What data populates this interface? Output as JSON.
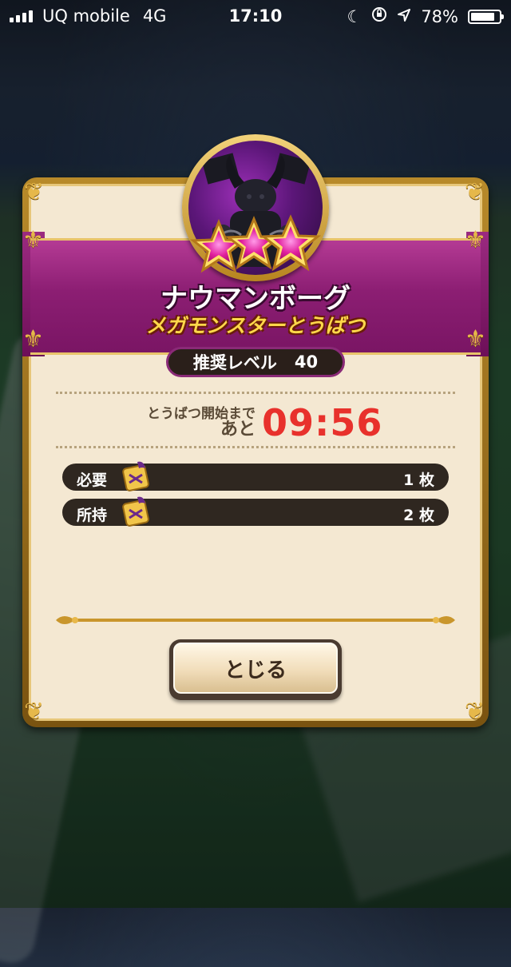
{
  "status_bar": {
    "carrier": "UQ mobile",
    "network": "4G",
    "time": "17:10",
    "battery": "78%",
    "battery_level": 0.78
  },
  "dialog": {
    "monster_name": "ナウマンボーグ",
    "subtitle": "メガモンスターとうばつ",
    "star_rating": 3,
    "recommended_level_label": "推奨レベル",
    "recommended_level_value": "40",
    "countdown_label_line1": "とうばつ開始まで",
    "countdown_label_line2": "あと",
    "countdown_value": "09:56",
    "required_label": "必要",
    "required_qty": "1 枚",
    "owned_label": "所持",
    "owned_qty": "2 枚",
    "close_label": "とじる"
  },
  "colors": {
    "ribbon": "#8c1e73",
    "panel_bg": "#f4e8d2",
    "countdown": "#e8312c",
    "gold": "#d5a63d"
  }
}
